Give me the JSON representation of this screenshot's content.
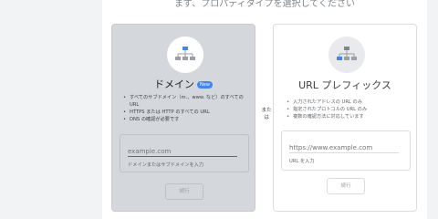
{
  "heading": "まず、プロパティタイプを選択してください",
  "separator": "または",
  "domain_card": {
    "title": "ドメイン",
    "badge": "New",
    "bullets": [
      "すべてのサブドメイン（m.、www. など）のすべての URL",
      "HTTPS または HTTP のすべての URL",
      "DNS の確認が必要です"
    ],
    "input_placeholder": "example.com",
    "input_value": "",
    "helper": "ドメインまたはサブドメインを入力",
    "continue_label": "続行",
    "icon": "sitemap-icon"
  },
  "url_card": {
    "title": "URL プレフィックス",
    "bullets": [
      "入力されたアドレスの URL のみ",
      "指定されたプロトコルの URL のみ",
      "複数の確認方法に対応しています"
    ],
    "input_placeholder": "https://www.example.com",
    "input_value": "",
    "helper": "URL を入力",
    "continue_label": "続行",
    "icon": "sitemap-icon"
  },
  "colors": {
    "accent": "#1a73e8",
    "badge": "#4285f4",
    "selected_card": "#d4d8dc"
  }
}
